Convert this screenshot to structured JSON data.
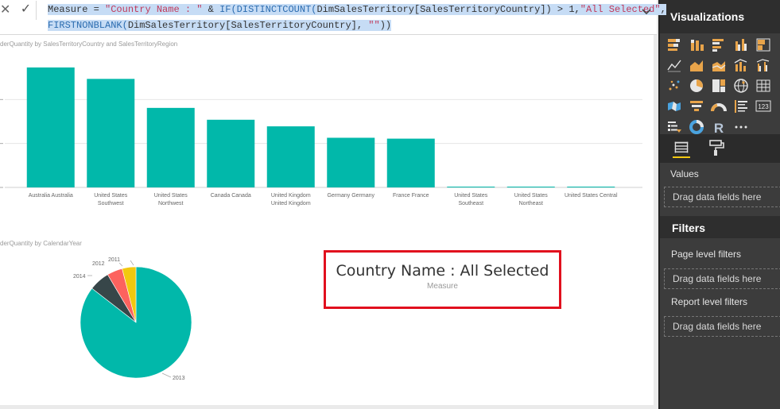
{
  "formula": {
    "cancel_icon": "close-icon",
    "commit_icon": "check-icon",
    "line1_a": "Measure",
    "line1_b": " = ",
    "line1_c": "\"Country Name : \"",
    "line1_d": " & ",
    "line1_e": "IF(DISTINCTCOUNT(",
    "line1_f": "DimSalesTerritory[SalesTerritoryCountry]",
    "line1_g": ") > 1,",
    "line1_h": "\"All Selected\"",
    "line1_i": ",",
    "line2_a": "FIRSTNONBLANK(",
    "line2_b": "DimSalesTerritory[SalesTerritoryCountry]",
    "line2_c": ", ",
    "line2_d": "\"\"",
    "line2_e": "))"
  },
  "bar_visual": {
    "title": "derQuantity by SalesTerritoryCountry and SalesTerritoryRegion"
  },
  "pie_visual": {
    "title": "derQuantity by CalendarYear"
  },
  "card": {
    "value": "Country Name : All Selected",
    "label": "Measure",
    "highlight_color": "#e1101e"
  },
  "chart_data": [
    {
      "type": "bar",
      "title": "derQuantity by SalesTerritoryCountry and SalesTerritoryRegion",
      "categories": [
        [
          "Australia Australia"
        ],
        [
          "United States",
          "Southwest"
        ],
        [
          "United States",
          "Northwest"
        ],
        [
          "Canada Canada"
        ],
        [
          "United Kingdom",
          "United Kingdom"
        ],
        [
          "Germany Germany"
        ],
        [
          "France France"
        ],
        [
          "United States",
          "Southeast"
        ],
        [
          "United States",
          "Northeast"
        ],
        [
          "United States Central"
        ]
      ],
      "values": [
        27.3,
        24.7,
        18.1,
        15.4,
        13.9,
        11.3,
        11.1,
        0.15,
        0.12,
        0.1
      ],
      "ylim": [
        0,
        30
      ],
      "gridlines": [
        10,
        20
      ],
      "grid": true,
      "color": "#01b8aa"
    },
    {
      "type": "pie",
      "title": "derQuantity by CalendarYear",
      "labels": [
        "2013",
        "2014",
        "2012",
        "2011"
      ],
      "values": [
        85.5,
        6.0,
        4.5,
        4.0
      ],
      "colors": [
        "#01b8aa",
        "#374649",
        "#fd625e",
        "#f2c80f"
      ]
    }
  ],
  "pane": {
    "visualizations_title": "Visualizations",
    "viz_icons": [
      "stacked-bar-icon",
      "stacked-column-icon",
      "clustered-bar-icon",
      "clustered-column-icon",
      "100-bar-icon",
      "line-icon",
      "area-icon",
      "stacked-area-icon",
      "line-column-icon",
      "line-clustered-column-icon",
      "scatter-icon",
      "pie-icon",
      "treemap-icon",
      "globe-map-icon",
      "table-icon",
      "filled-map-icon",
      "funnel-icon",
      "gauge-icon",
      "multirow-card-icon",
      "card-icon",
      "slicer-icon",
      "donut-icon",
      "r-visual-icon",
      "more-icon"
    ],
    "fields_tab_icon": "fields-icon",
    "format_tab_icon": "paint-roller-icon",
    "values_label": "Values",
    "values_well": "Drag data fields here",
    "filters_title": "Filters",
    "page_filters_label": "Page level filters",
    "page_filters_well": "Drag data fields here",
    "report_filters_label": "Report level filters",
    "report_filters_well": "Drag data fields here"
  }
}
